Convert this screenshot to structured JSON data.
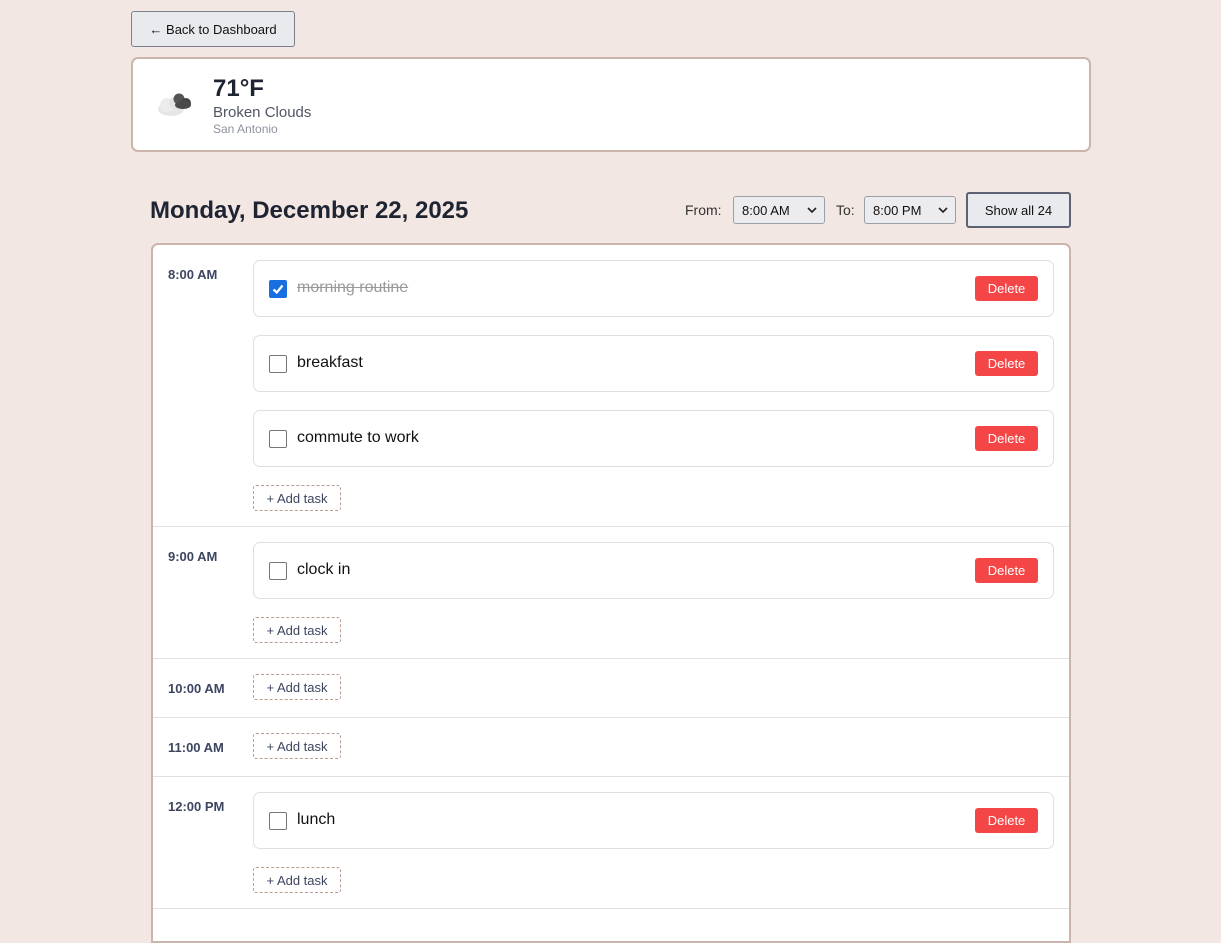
{
  "nav": {
    "back_label": "← Back to Dashboard"
  },
  "weather": {
    "icon": "broken-clouds-icon",
    "temperature": "71°F",
    "condition": "Broken Clouds",
    "city": "San Antonio"
  },
  "day": {
    "title": "Monday, December 22, 2025",
    "from_label": "From:",
    "from_value": "8:00 AM",
    "to_label": "To:",
    "to_value": "8:00 PM",
    "show_all_label": "Show all 24"
  },
  "labels": {
    "delete": "Delete",
    "add_task": "+ Add task"
  },
  "colors": {
    "accent": "#1a6fe0",
    "danger": "#f44646",
    "background": "#f2e7e2"
  },
  "slots": [
    {
      "hour": "8:00 AM",
      "tasks": [
        {
          "title": "morning routine",
          "done": true
        },
        {
          "title": "breakfast",
          "done": false
        },
        {
          "title": "commute to work",
          "done": false
        }
      ]
    },
    {
      "hour": "9:00 AM",
      "tasks": [
        {
          "title": "clock in",
          "done": false
        }
      ]
    },
    {
      "hour": "10:00 AM",
      "tasks": []
    },
    {
      "hour": "11:00 AM",
      "tasks": []
    },
    {
      "hour": "12:00 PM",
      "tasks": [
        {
          "title": "lunch",
          "done": false
        }
      ]
    }
  ]
}
